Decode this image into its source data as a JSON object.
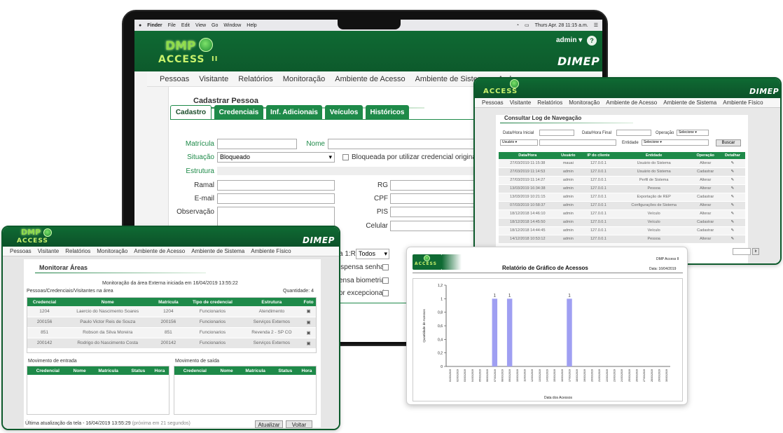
{
  "colors": {
    "brand_green": "#0f6a33",
    "tab_green": "#1e8a49",
    "accent_logo": "#8fdc4a",
    "chart_bar": "#9f9ff2"
  },
  "brand": {
    "logo_top": "DMP",
    "logo_bottom": "ACCESS",
    "logo_suffix": "II",
    "company": "DIMEP"
  },
  "mac_menu": {
    "items": [
      "Finder",
      "File",
      "Edit",
      "View",
      "Go",
      "Window",
      "Help"
    ],
    "clock": "Thurs Apr. 28 11:15 a.m."
  },
  "user_menu": {
    "label": "admin ▾",
    "help": "?"
  },
  "main_nav": [
    "Pessoas",
    "Visitante",
    "Relatórios",
    "Monitoração",
    "Ambiente de Acesso",
    "Ambiente de Sistema",
    "Amb"
  ],
  "cadastro": {
    "title": "Cadastrar Pessoa",
    "tabs": [
      "Cadastro",
      "Credenciais",
      "Inf. Adicionais",
      "Veículos",
      "Históricos"
    ],
    "labels": {
      "matricula": "Matrícula",
      "nome": "Nome",
      "situacao": "Situação",
      "estrutura": "Estrutura",
      "ramal": "Ramal",
      "email": "E-mail",
      "observacao": "Observação",
      "rg": "RG",
      "cpf": "CPF",
      "pis": "PIS",
      "celular": "Celular"
    },
    "situacao_value": "Bloqueado",
    "bloqueio_text": "Bloqueada por utilizar credencial original co",
    "partial_1r_label": "a 1:R",
    "partial_1r_value": "Todos",
    "partial_checks": [
      "ispensa senha",
      "ensa biometria",
      "or excepcional"
    ]
  },
  "log": {
    "nav": [
      "Pessoas",
      "Visitante",
      "Relatórios",
      "Monitoração",
      "Ambiente de Acesso",
      "Ambiente de Sistema",
      "Ambiente Físico"
    ],
    "title": "Consultar Log de Navegação",
    "filters": {
      "data_inicial": "Data/Hora Inicial",
      "data_final": "Data/Hora Final",
      "operacao": "Operação",
      "operacao_value": "Selecione",
      "usuario_value": "Usuário",
      "entidade": "Entidade",
      "entidade_value": "Selecione",
      "buscar": "Buscar"
    },
    "columns": [
      "Data/Hora",
      "Usuário",
      "IP do cliente",
      "Entidade",
      "Operação",
      "Detalhar"
    ],
    "rows": [
      [
        "27/03/2019 11:15:38",
        "mauai",
        "127.0.0.1",
        "Usuário do Sistema",
        "Alterar"
      ],
      [
        "27/03/2019 11:14:53",
        "admin",
        "127.0.0.1",
        "Usuário do Sistema",
        "Cadastrar"
      ],
      [
        "27/03/2019 11:14:27",
        "admin",
        "127.0.0.1",
        "Perfil de Sistema",
        "Alterar"
      ],
      [
        "13/03/2019 16:34:38",
        "admin",
        "127.0.0.1",
        "Pessoa",
        "Alterar"
      ],
      [
        "13/03/2019 10:21:15",
        "admin",
        "127.0.0.1",
        "Exportação de REP",
        "Cadastrar"
      ],
      [
        "07/03/2019 10:58:37",
        "admin",
        "127.0.0.1",
        "Configurações de Sistema",
        "Alterar"
      ],
      [
        "18/12/2018 14:46:10",
        "admin",
        "127.0.0.1",
        "Veículo",
        "Alterar"
      ],
      [
        "18/12/2018 14:45:50",
        "admin",
        "127.0.0.1",
        "Veículo",
        "Cadastrar"
      ],
      [
        "18/12/2018 14:44:45",
        "admin",
        "127.0.0.1",
        "Veículo",
        "Cadastrar"
      ],
      [
        "14/12/2018 10:53:12",
        "admin",
        "127.0.0.1",
        "Pessoa",
        "Alterar"
      ]
    ],
    "page_button": "Ir"
  },
  "monitor": {
    "nav": [
      "Pessoas",
      "Visitante",
      "Relatórios",
      "Monitoração",
      "Ambiente de Acesso",
      "Ambiente de Sistema",
      "Ambiente Físico"
    ],
    "title": "Monitorar Áreas",
    "subtitle": "Monitoração da área Externa iniciada em 16/04/2019 13:55:22",
    "area_label": "Pessoas/Credenciais/Visitantes na área",
    "quantidade": "Quantidade: 4",
    "columns": [
      "Credencial",
      "Nome",
      "Matrícula",
      "Tipo de credencial",
      "Estrutura",
      "Foto"
    ],
    "rows": [
      [
        "1204",
        "Laercio do Nascimento Soares",
        "1204",
        "Funcionarios",
        "Atendimento"
      ],
      [
        "200156",
        "Paulo Victor Reis de Souza",
        "200156",
        "Funcionarios",
        "Serviços Externos"
      ],
      [
        "851",
        "Robson da Silva Moreira",
        "851",
        "Funcionarios",
        "Revenda 2 - SP CO"
      ],
      [
        "200142",
        "Rodrigo do Nascimento Costa",
        "200142",
        "Funcionarios",
        "Serviços Externos"
      ]
    ],
    "entrada_title": "Movimento de entrada",
    "saida_title": "Movimento de saída",
    "mov_columns": [
      "Credencial",
      "Nome",
      "Matrícula",
      "Status",
      "Hora"
    ],
    "footer_text": "Última atualização da tela - 16/04/2019 13:55:29",
    "footer_hint": "(próxima em 21 segundos)",
    "btn_atualizar": "Atualizar",
    "btn_voltar": "Voltar"
  },
  "report": {
    "title": "Relatório de Gráfico de Acessos",
    "product": "DMP Access II",
    "date": "Data: 16/04/2019"
  },
  "chart_data": {
    "type": "bar",
    "title": "Relatório de Gráfico de Acessos",
    "xlabel": "Data dos Acessos",
    "ylabel": "Quantidade de Acessos",
    "ylim": [
      0,
      1.2
    ],
    "yticks": [
      "0",
      "0,2",
      "0,4",
      "0,6",
      "0,8",
      "1",
      "1,2"
    ],
    "grid": false,
    "categories": [
      "01/03/2019",
      "02/03/2019",
      "03/03/2019",
      "04/03/2019",
      "05/03/2019",
      "06/03/2019",
      "07/03/2019",
      "08/03/2019",
      "09/03/2019",
      "10/03/2019",
      "11/03/2019",
      "12/03/2019",
      "13/03/2019",
      "14/03/2019",
      "15/03/2019",
      "16/03/2019",
      "17/03/2019",
      "18/03/2019",
      "19/03/2019",
      "20/03/2019",
      "21/03/2019",
      "22/03/2019",
      "23/03/2019",
      "24/03/2019",
      "25/03/2019",
      "26/03/2019",
      "27/03/2019",
      "28/03/2019",
      "29/03/2019",
      "30/03/2019"
    ],
    "values": [
      0,
      0,
      0,
      0,
      0,
      0,
      1,
      0,
      1,
      0,
      0,
      0,
      0,
      0,
      0,
      0,
      1,
      0,
      0,
      0,
      0,
      0,
      0,
      0,
      0,
      0,
      0,
      0,
      0,
      0
    ],
    "data_labels": [
      "",
      "",
      "",
      "",
      "",
      "",
      "1",
      "",
      "1",
      "",
      "",
      "",
      "",
      "",
      "",
      "",
      "1",
      "",
      "",
      "",
      "",
      "",
      "",
      "",
      "",
      "",
      "",
      "",
      "",
      ""
    ]
  }
}
